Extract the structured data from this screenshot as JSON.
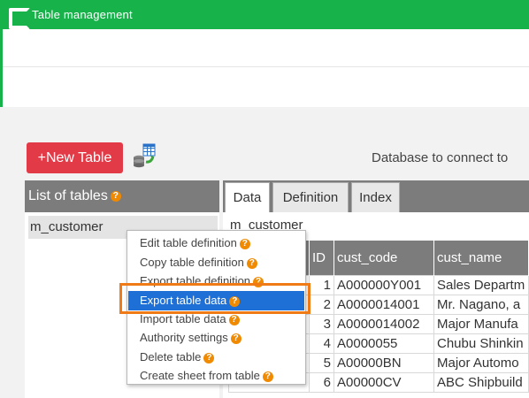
{
  "window": {
    "title": "Table management",
    "logo_icon": "app-logo-icon"
  },
  "toolbar": {
    "new_table_label": "+New Table",
    "db_icon": "database-refresh-icon",
    "database_label": "Database to connect to"
  },
  "list_panel": {
    "header": "List of tables",
    "help": "?",
    "items": [
      "m_customer"
    ]
  },
  "tabs": [
    {
      "label": "Data",
      "active": true
    },
    {
      "label": "Definition",
      "active": false
    },
    {
      "label": "Index",
      "active": false
    }
  ],
  "table": {
    "name": "m_customer",
    "columns": [
      "ID",
      "cust_code",
      "cust_name"
    ],
    "rows": [
      [
        "1",
        "A000000Y001",
        "Sales Departm"
      ],
      [
        "2",
        "A0000014001",
        "Mr. Nagano, a"
      ],
      [
        "3",
        "A0000014002",
        "Major Manufa"
      ],
      [
        "4",
        "A0000055",
        "Chubu Shinkin"
      ],
      [
        "5",
        "A00000BN",
        "Major Automo"
      ],
      [
        "6",
        "A00000CV",
        "ABC Shipbuild"
      ]
    ]
  },
  "context_menu": {
    "highlight_color": "#1e6fd6",
    "frame_color": "#f07a16",
    "items": [
      {
        "label": "Edit table definition",
        "help": "?",
        "highlighted": false
      },
      {
        "label": "Copy table definition",
        "help": "?",
        "highlighted": false
      },
      {
        "label": "Export table definition",
        "help": "?",
        "highlighted": false
      },
      {
        "label": "Export table data",
        "help": "?",
        "highlighted": true
      },
      {
        "label": "Import table data",
        "help": "?",
        "highlighted": false
      },
      {
        "label": "Authority settings",
        "help": "?",
        "highlighted": false
      },
      {
        "label": "Delete table",
        "help": "?",
        "highlighted": false
      },
      {
        "label": "Create sheet from table",
        "help": "?",
        "highlighted": false
      }
    ]
  }
}
